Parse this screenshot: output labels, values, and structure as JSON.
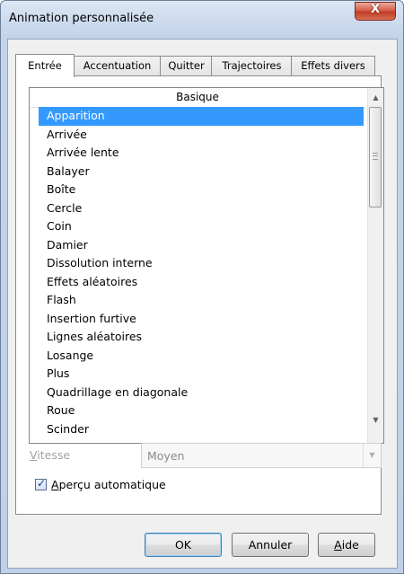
{
  "window": {
    "title": "Animation personnalisée",
    "close_label": "X"
  },
  "tabs": [
    {
      "label": "Entrée",
      "active": true
    },
    {
      "label": "Accentuation",
      "active": false
    },
    {
      "label": "Quitter",
      "active": false
    },
    {
      "label": "Trajectoires",
      "active": false
    },
    {
      "label": "Effets divers",
      "active": false
    }
  ],
  "list": {
    "header": "Basique",
    "selected_index": 0,
    "items": [
      "Apparition",
      "Arrivée",
      "Arrivée lente",
      "Balayer",
      "Boîte",
      "Cercle",
      "Coin",
      "Damier",
      "Dissolution interne",
      "Effets aléatoires",
      "Flash",
      "Insertion furtive",
      "Lignes aléatoires",
      "Losange",
      "Plus",
      "Quadrillage en diagonale",
      "Roue",
      "Scinder"
    ]
  },
  "speed": {
    "label_first": "V",
    "label_rest": "itesse",
    "value": "Moyen",
    "enabled": false
  },
  "auto_preview": {
    "label_first": "A",
    "label_rest": "perçu automatique",
    "checked": true
  },
  "buttons": {
    "ok": "OK",
    "cancel": "Annuler",
    "help_first": "A",
    "help_rest": "ide"
  },
  "icons": {
    "scroll_up": "▲",
    "scroll_down": "▼",
    "combo_arrow": "▼",
    "check": "✓"
  }
}
